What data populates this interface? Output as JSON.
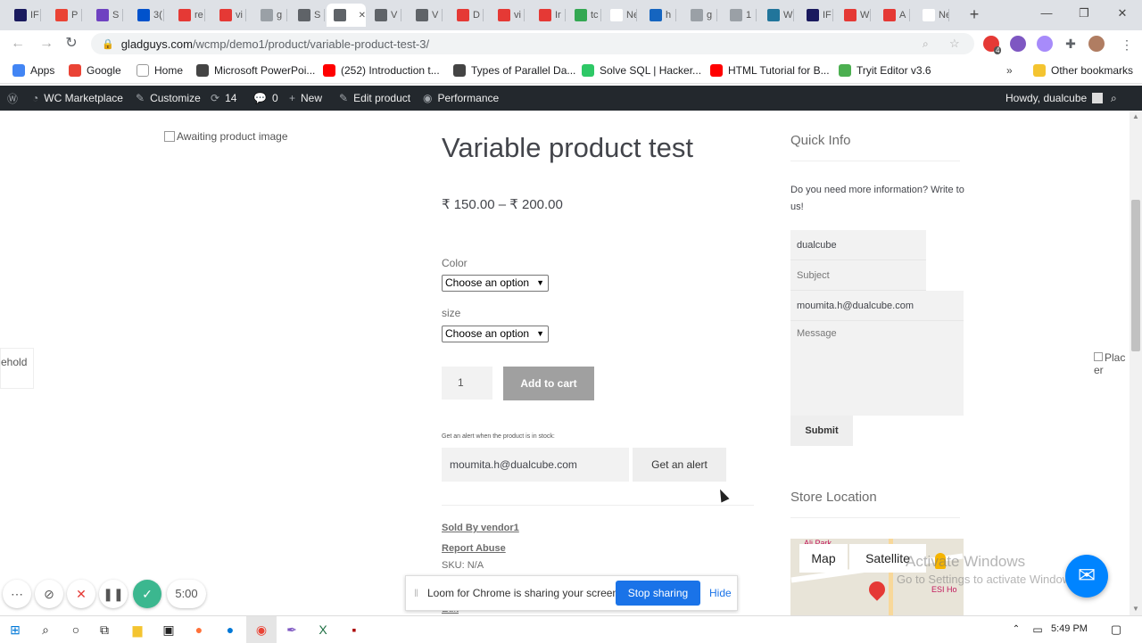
{
  "browser": {
    "tabs": [
      {
        "title": "IF",
        "color": "#1a1a5e"
      },
      {
        "title": "P",
        "color": "#ea4335"
      },
      {
        "title": "S",
        "color": "#6f42c1"
      },
      {
        "title": "3(",
        "color": "#0052cc"
      },
      {
        "title": "re",
        "color": "#e53935"
      },
      {
        "title": "vi",
        "color": "#e53935"
      },
      {
        "title": "g",
        "color": "#9aa0a6"
      },
      {
        "title": "S",
        "color": "#5f6368"
      },
      {
        "title": "",
        "color": "#5f6368"
      },
      {
        "title": "V",
        "color": "#5f6368"
      },
      {
        "title": "V",
        "color": "#5f6368"
      },
      {
        "title": "D",
        "color": "#e53935"
      },
      {
        "title": "vi",
        "color": "#e53935"
      },
      {
        "title": "Ir",
        "color": "#e53935"
      },
      {
        "title": "tc",
        "color": "#34a853"
      },
      {
        "title": "New",
        "color": "#ffffff"
      },
      {
        "title": "h",
        "color": "#1565c0"
      },
      {
        "title": "g",
        "color": "#9aa0a6"
      },
      {
        "title": "1",
        "color": "#9aa0a6"
      },
      {
        "title": "W",
        "color": "#21759b"
      },
      {
        "title": "IF",
        "color": "#1a1a5e"
      },
      {
        "title": "W",
        "color": "#e53935"
      },
      {
        "title": "A",
        "color": "#e53935"
      },
      {
        "title": "New",
        "color": "#ffffff"
      }
    ],
    "new_tab_icon": "plus-icon",
    "url_host": "gladguys.com",
    "url_path": "/wcmp/demo1/product/variable-product-test-3/",
    "extension_badge": "4"
  },
  "bookmarks": [
    {
      "label": "Apps",
      "color": "#4285f4"
    },
    {
      "label": "Google",
      "color": "#ea4335"
    },
    {
      "label": "Home",
      "color": "#ffffff"
    },
    {
      "label": "Microsoft PowerPoi...",
      "color": "#444444"
    },
    {
      "label": "(252) Introduction t...",
      "color": "#ff0000"
    },
    {
      "label": "Types of Parallel Da...",
      "color": "#444444"
    },
    {
      "label": "Solve SQL | Hacker...",
      "color": "#2ec866"
    },
    {
      "label": "HTML Tutorial for B...",
      "color": "#ff0000"
    },
    {
      "label": "Tryit Editor v3.6",
      "color": "#4caf50"
    }
  ],
  "other_bookmarks": "Other bookmarks",
  "wpbar": {
    "marketplace": "WC Marketplace",
    "customize": "Customize",
    "updates": "14",
    "comments": "0",
    "new": "New",
    "edit_product": "Edit product",
    "performance": "Performance",
    "howdy": "Howdy, dualcube"
  },
  "product": {
    "image_alt": "Awaiting product image",
    "title": "Variable product test",
    "price": "₹ 150.00 – ₹ 200.00",
    "color_label": "Color",
    "color_value": "Choose an option",
    "size_label": "size",
    "size_value": "Choose an option",
    "quantity": "1",
    "add_to_cart": "Add to cart",
    "alert_note": "Get an alert when the product is in stock:",
    "alert_email": "moumita.h@dualcube.com",
    "alert_button": "Get an alert",
    "sold_by": "Sold By vendor1",
    "report_abuse": "Report Abuse",
    "sku": "SKU: N/A",
    "edit": "Edit"
  },
  "sidebar": {
    "quick_info_title": "Quick Info",
    "quick_info_text": "Do you need more information? Write to us!",
    "name_value": "dualcube",
    "subject_placeholder": "Subject",
    "email_value": "moumita.h@dualcube.com",
    "message_placeholder": "Message",
    "submit": "Submit",
    "store_location_title": "Store Location",
    "map_tab": "Map",
    "satellite_tab": "Satellite",
    "map_label_1": "Ali Park",
    "map_label_2": "ESI Ho"
  },
  "side_tabs": {
    "left": "ehold",
    "right": "Plac er"
  },
  "watermark": {
    "line1": "Activate Windows",
    "line2": "Go to Settings to activate Windows."
  },
  "loom": {
    "message": "Loom for Chrome is sharing your screen.",
    "stop": "Stop sharing",
    "hide": "Hide",
    "timer": "5:00"
  },
  "taskbar": {
    "time": "5:49 PM"
  }
}
